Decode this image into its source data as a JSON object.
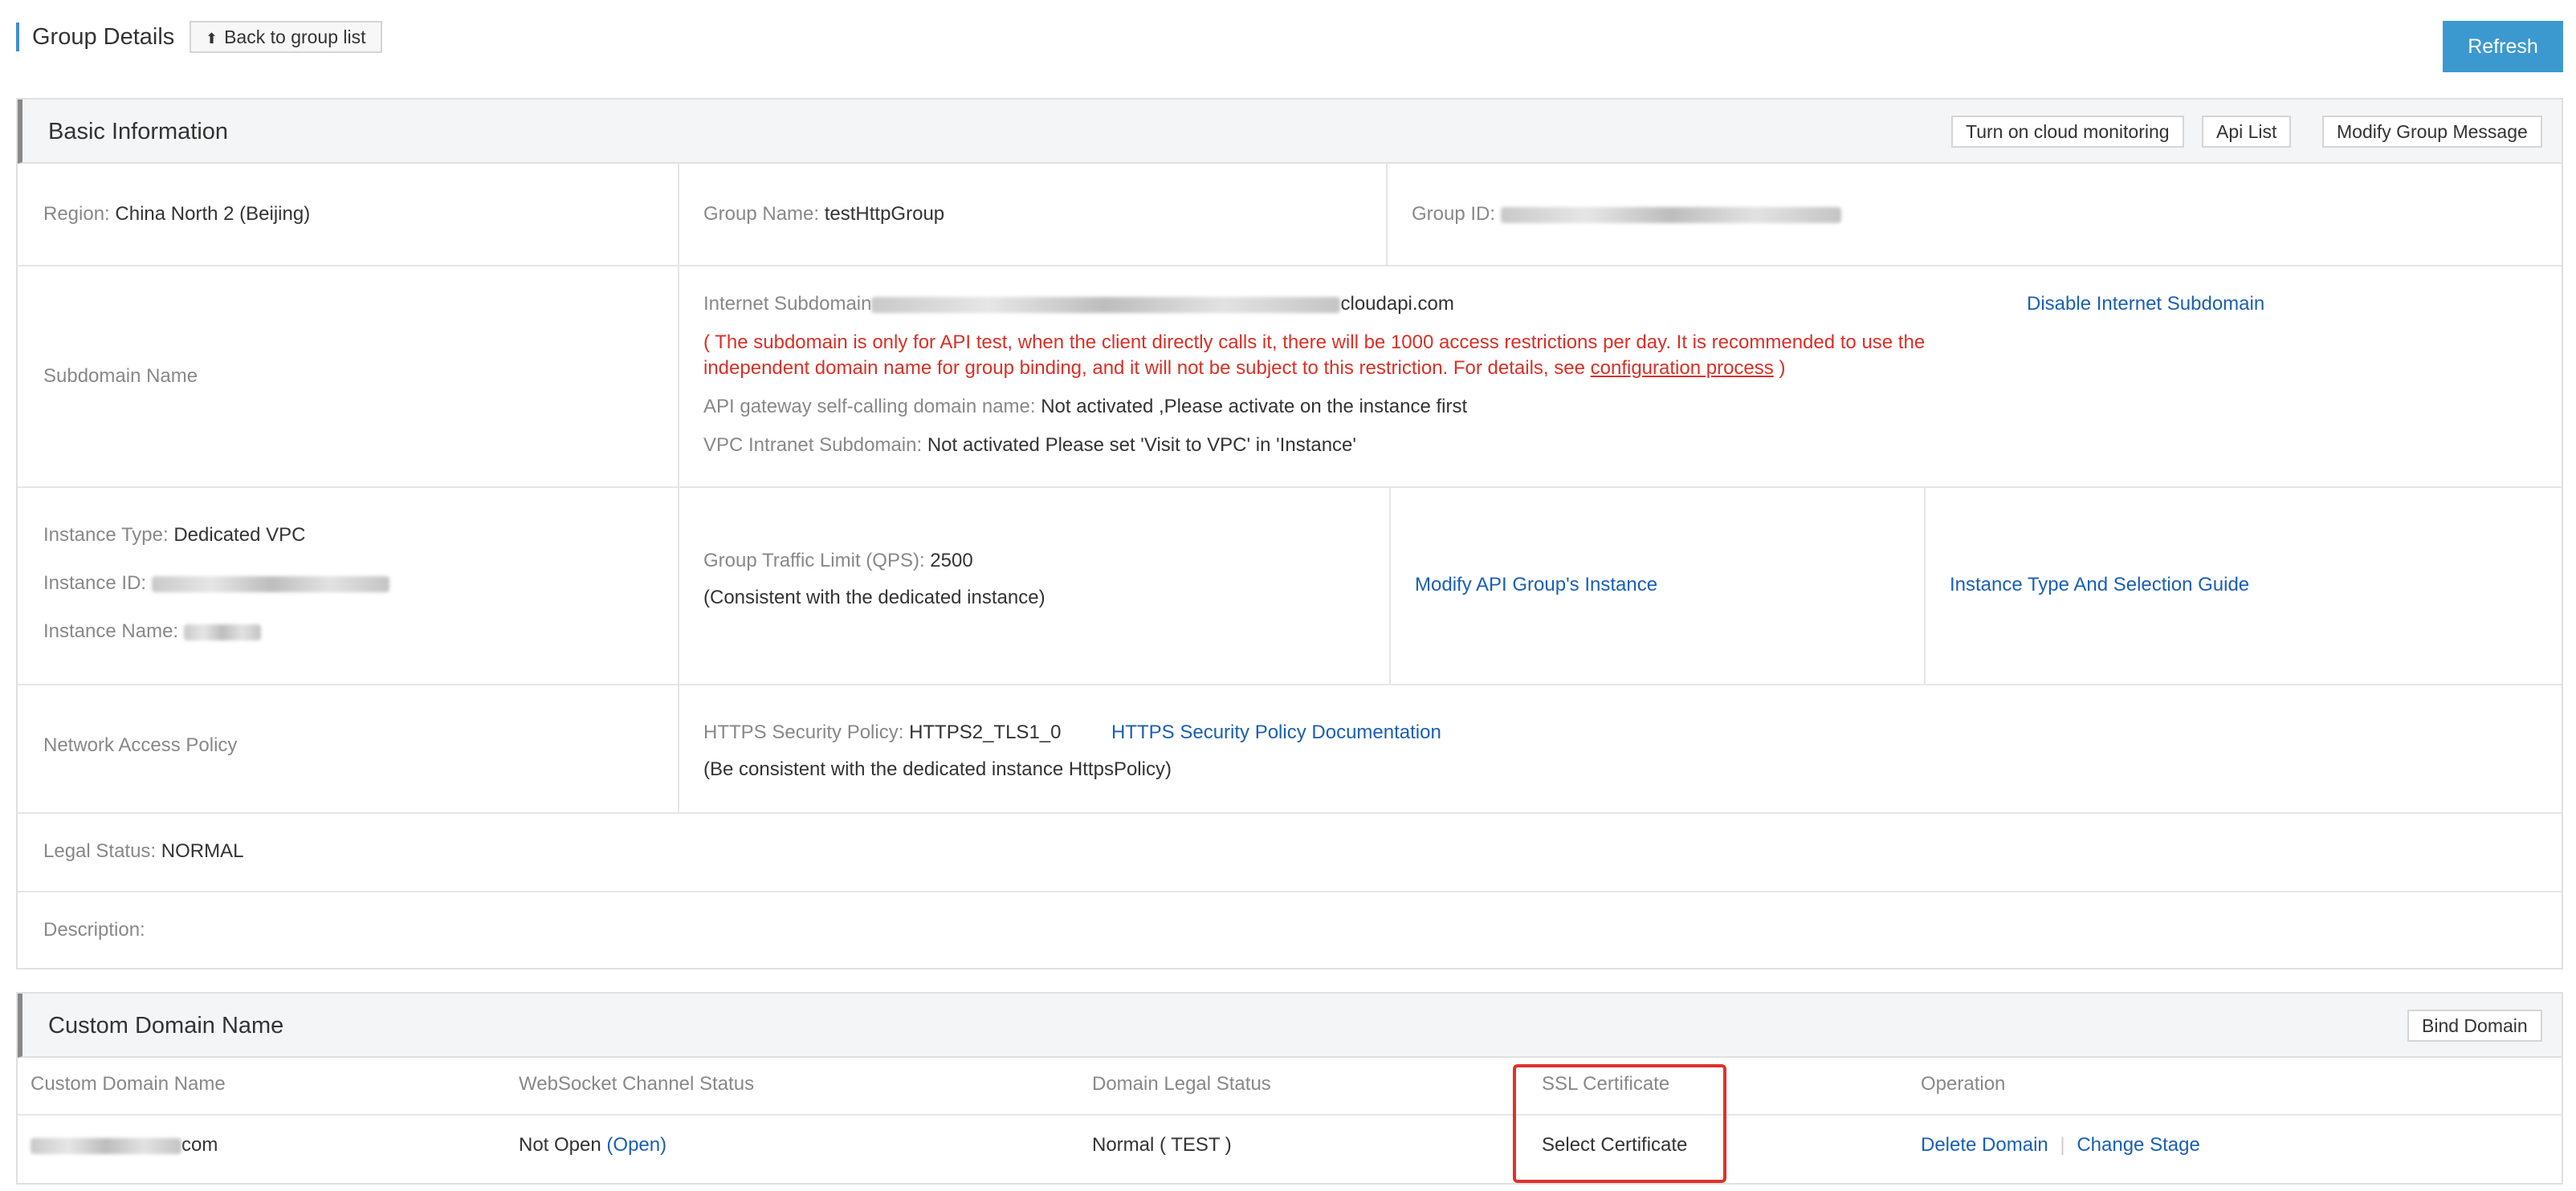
{
  "header": {
    "title": "Group Details",
    "back_label": "Back to group list",
    "refresh_label": "Refresh"
  },
  "basic": {
    "title": "Basic Information",
    "buttons": {
      "cloud_monitoring": "Turn on cloud monitoring",
      "api_list": "Api List",
      "modify_group": "Modify Group Message"
    },
    "region_label": "Region:",
    "region_value": "China North 2 (Beijing)",
    "group_name_label": "Group Name:",
    "group_name_value": "testHttpGroup",
    "group_id_label": "Group ID:",
    "subdomain_label": "Subdomain Name",
    "internet_subdomain_label": "Internet Subdomain",
    "internet_subdomain_suffix": "cloudapi.com",
    "disable_internet_subdomain": "Disable Internet Subdomain",
    "notice_line1": "( The subdomain is only for API test, when the client directly calls it, there will be 1000 access restrictions per day. It is recommended to use the",
    "notice_line2_pre": "independent domain name for group binding, and it will not be subject to this restriction. For details, see",
    "notice_link": "configuration process",
    "notice_close": ")",
    "self_calling_label": "API gateway self-calling domain name:",
    "self_calling_value": "Not activated ,Please activate on the instance first",
    "vpc_label": "VPC Intranet Subdomain:",
    "vpc_value": "Not activated Please set 'Visit to VPC' in 'Instance'",
    "instance_type_label": "Instance Type:",
    "instance_type_value": "Dedicated VPC",
    "instance_id_label": "Instance ID:",
    "instance_name_label": "Instance Name:",
    "traffic_label": "Group Traffic Limit (QPS):",
    "traffic_value": "2500",
    "traffic_note": "(Consistent with the dedicated instance)",
    "modify_instance_link": "Modify API Group's Instance",
    "instance_guide_link": "Instance Type And Selection Guide",
    "network_policy_label": "Network Access Policy",
    "https_policy_label": "HTTPS Security Policy:",
    "https_policy_value": "HTTPS2_TLS1_0",
    "https_doc_link": "HTTPS Security Policy Documentation",
    "https_note": "(Be consistent with the dedicated instance HttpsPolicy)",
    "legal_status_label": "Legal Status:",
    "legal_status_value": "NORMAL",
    "description_label": "Description:"
  },
  "custom_domain": {
    "title": "Custom Domain Name",
    "bind_button": "Bind Domain",
    "columns": [
      "Custom Domain Name",
      "WebSocket Channel Status",
      "Domain Legal Status",
      "SSL Certificate",
      "Operation"
    ],
    "row": {
      "domain_suffix": "com",
      "websocket_status": "Not Open",
      "websocket_open_link": "(Open)",
      "legal_status": "Normal ( TEST )",
      "ssl_link": "Select Certificate",
      "delete_link": "Delete Domain",
      "separator": "|",
      "change_stage_link": "Change Stage"
    }
  },
  "colors": {
    "accent": "#3c99cf",
    "link": "#1a5fb4",
    "warning": "#d93026",
    "highlight_box": "#e0312b"
  }
}
